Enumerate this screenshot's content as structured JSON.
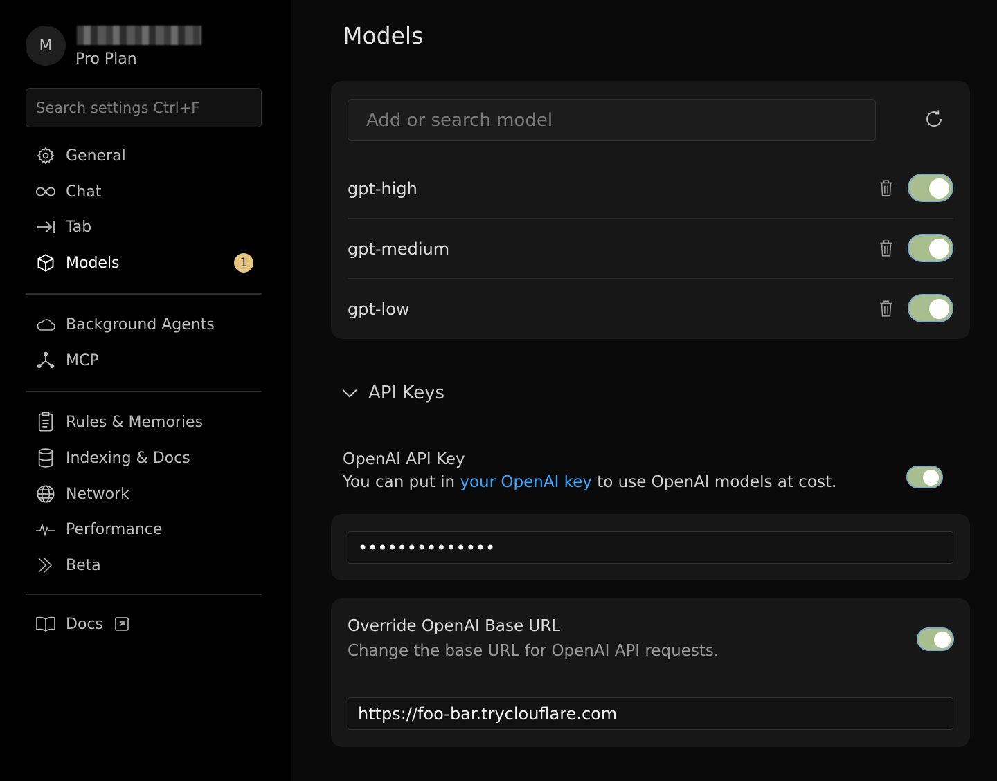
{
  "profile": {
    "avatar_letter": "M",
    "plan": "Pro Plan"
  },
  "search": {
    "placeholder": "Search settings Ctrl+F"
  },
  "sidebar": {
    "items": [
      {
        "label": "General",
        "icon": "gear-icon"
      },
      {
        "label": "Chat",
        "icon": "infinity-icon"
      },
      {
        "label": "Tab",
        "icon": "tab-arrow-icon"
      },
      {
        "label": "Models",
        "icon": "cube-icon",
        "active": true,
        "badge": "1"
      },
      {
        "label": "Background Agents",
        "icon": "cloud-icon"
      },
      {
        "label": "MCP",
        "icon": "network-nodes-icon"
      },
      {
        "label": "Rules & Memories",
        "icon": "clipboard-icon"
      },
      {
        "label": "Indexing & Docs",
        "icon": "database-icon"
      },
      {
        "label": "Network",
        "icon": "globe-icon"
      },
      {
        "label": "Performance",
        "icon": "pulse-icon"
      },
      {
        "label": "Beta",
        "icon": "double-chevron-icon"
      },
      {
        "label": "Docs",
        "icon": "book-icon"
      }
    ]
  },
  "main": {
    "title": "Models",
    "model_search_placeholder": "Add or search model",
    "models": [
      {
        "name": "gpt-high",
        "enabled": true
      },
      {
        "name": "gpt-medium",
        "enabled": true
      },
      {
        "name": "gpt-low",
        "enabled": true
      }
    ],
    "api_keys": {
      "section_title": "API Keys",
      "openai": {
        "title": "OpenAI API Key",
        "desc_before": "You can put in ",
        "desc_link": "your OpenAI key",
        "desc_after": " to use OpenAI models at cost.",
        "enabled": true,
        "value": "••••••••••••••"
      },
      "override": {
        "title": "Override OpenAI Base URL",
        "desc": "Change the base URL for OpenAI API requests.",
        "enabled": true,
        "value": "https://foo-bar.tryclouflare.com"
      }
    }
  },
  "colors": {
    "toggle_on": "#a9be8e",
    "link": "#3ea6ff",
    "badge": "#e8c582"
  }
}
